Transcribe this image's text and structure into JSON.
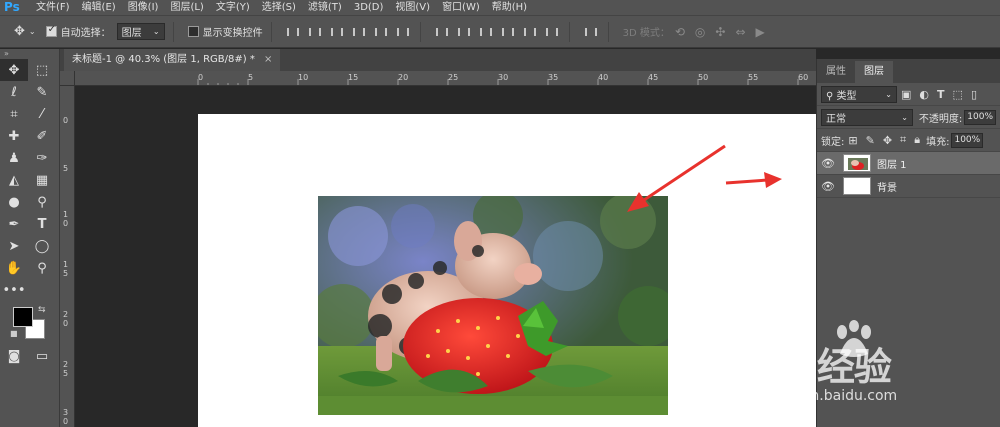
{
  "app": {
    "logo": "Ps"
  },
  "menu": [
    "文件(F)",
    "编辑(E)",
    "图像(I)",
    "图层(L)",
    "文字(Y)",
    "选择(S)",
    "滤镜(T)",
    "3D(D)",
    "视图(V)",
    "窗口(W)",
    "帮助(H)"
  ],
  "options": {
    "auto_select_label": "自动选择：",
    "auto_select_checked": true,
    "auto_select_value": "图层",
    "transform_label": "显示变换控件",
    "transform_checked": false,
    "mode_3d_label": "3D 模式："
  },
  "document_tab": {
    "title": "未标题-1 @ 40.3% (图层 1, RGB/8#) *",
    "close": "×"
  },
  "rulers": {
    "top": [
      "0",
      "5",
      "10",
      "15",
      "20",
      "25",
      "30",
      "35",
      "40",
      "45",
      "50",
      "55",
      "60"
    ],
    "left": [
      "0",
      "5",
      "1 0",
      "1 5",
      "2 0",
      "2 5",
      "3 0"
    ]
  },
  "panel": {
    "tabs": [
      "属性",
      "图层"
    ],
    "active_tab": "图层",
    "filter_label": "类型",
    "blend_mode": "正常",
    "opacity_label": "不透明度:",
    "opacity_value": "100%",
    "lock_label": "锁定:",
    "fill_label": "填充:",
    "fill_value": "100%",
    "layers": [
      {
        "name": "图层 1",
        "visible": true,
        "selected": true
      },
      {
        "name": "背景",
        "visible": true,
        "selected": false
      }
    ]
  },
  "watermark": {
    "text": "Bai 经验",
    "url": "jingyan.baidu.com"
  },
  "colors": {
    "accent": "#31a8ff",
    "foreground": "#000000",
    "background": "#ffffff",
    "annotation_arrow": "#e8322d"
  }
}
